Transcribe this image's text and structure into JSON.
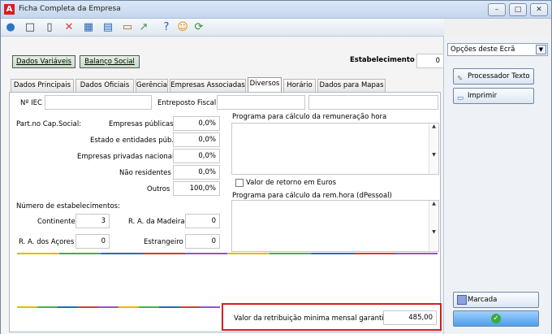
{
  "window": {
    "title": "Ficha Completa da Empresa"
  },
  "buttons": {
    "variables": "Dados Variáveis",
    "social": "Balanço Social"
  },
  "establishment": {
    "label": "Estabelecimento Nº",
    "value": "0"
  },
  "tabs": [
    "Dados Principais",
    "Dados Oficiais",
    "Gerência",
    "Empresas Associadas",
    "Diversos",
    "Horário",
    "Dados para Mapas"
  ],
  "form": {
    "niec": "Nº IEC",
    "entreposto": "Entreposto Fiscal",
    "part": "Part.no Cap.Social:",
    "rows": [
      {
        "label": "Empresas públicas",
        "value": "0,0%"
      },
      {
        "label": "Estado e entidades púb.",
        "value": "0,0%"
      },
      {
        "label": "Empresas privadas nacionais",
        "value": "0,0%"
      },
      {
        "label": "Não residentes",
        "value": "0,0%"
      },
      {
        "label": "Outros",
        "value": "100,0%"
      }
    ],
    "num_estab": "Número de estabelecimentos:",
    "continente": {
      "label": "Continente",
      "value": "3"
    },
    "madeira": {
      "label": "R. A. da Madeira",
      "value": "0"
    },
    "acores": {
      "label": "R. A. dos Açores",
      "value": "0"
    },
    "estrangeiro": {
      "label": "Estrangeiro",
      "value": "0"
    },
    "programa1": "Programa para cálculo da remuneração hora",
    "valor_euros": "Valor de retorno em Euros",
    "programa2": "Programa para cálculo da rem.hora (dPessoal)",
    "rmmg": {
      "label": "Valor da retribuição minima mensal garantida",
      "value": "485,00"
    }
  },
  "right": {
    "select": "Opções deste Ecrã",
    "proc": "Processador Texto",
    "print": "Imprimir",
    "marcada": "Marcada"
  },
  "colors": {
    "accent": "#d32020",
    "toolbar": "#dfe7f1"
  }
}
